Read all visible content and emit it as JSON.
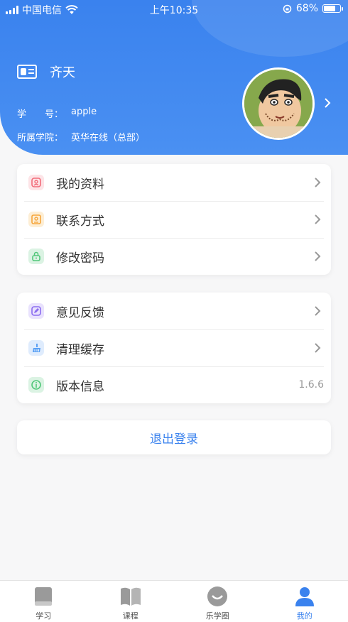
{
  "status_bar": {
    "carrier": "中国电信",
    "time": "上午10:35",
    "battery": "68%",
    "battery_level": 0.68
  },
  "profile": {
    "name": "齐天",
    "student_id_label": "学　　号：",
    "student_id": "apple",
    "school_label": "所属学院：",
    "school": "英华在线（总部）"
  },
  "account_menu": [
    {
      "label": "我的资料",
      "icon": "profile-icon",
      "color": "#f26d7a"
    },
    {
      "label": "联系方式",
      "icon": "contact-card-icon",
      "color": "#f6a63c"
    },
    {
      "label": "修改密码",
      "icon": "lock-icon",
      "color": "#52c77a"
    }
  ],
  "settings_menu": [
    {
      "label": "意见反馈",
      "icon": "feedback-icon",
      "color": "#8b6cf0"
    },
    {
      "label": "清理缓存",
      "icon": "broom-icon",
      "color": "#5aa0f4"
    },
    {
      "label": "版本信息",
      "icon": "info-icon",
      "color": "#52c77a",
      "value": "1.6.6"
    }
  ],
  "logout_label": "退出登录",
  "tabbar": [
    {
      "label": "学习",
      "icon": "study-icon",
      "active": false
    },
    {
      "label": "课程",
      "icon": "book-icon",
      "active": false
    },
    {
      "label": "乐学圈",
      "icon": "circle-icon",
      "active": false
    },
    {
      "label": "我的",
      "icon": "user-icon",
      "active": true
    }
  ],
  "colors": {
    "accent": "#3a82ee",
    "header_bg": "#4a90f2"
  }
}
